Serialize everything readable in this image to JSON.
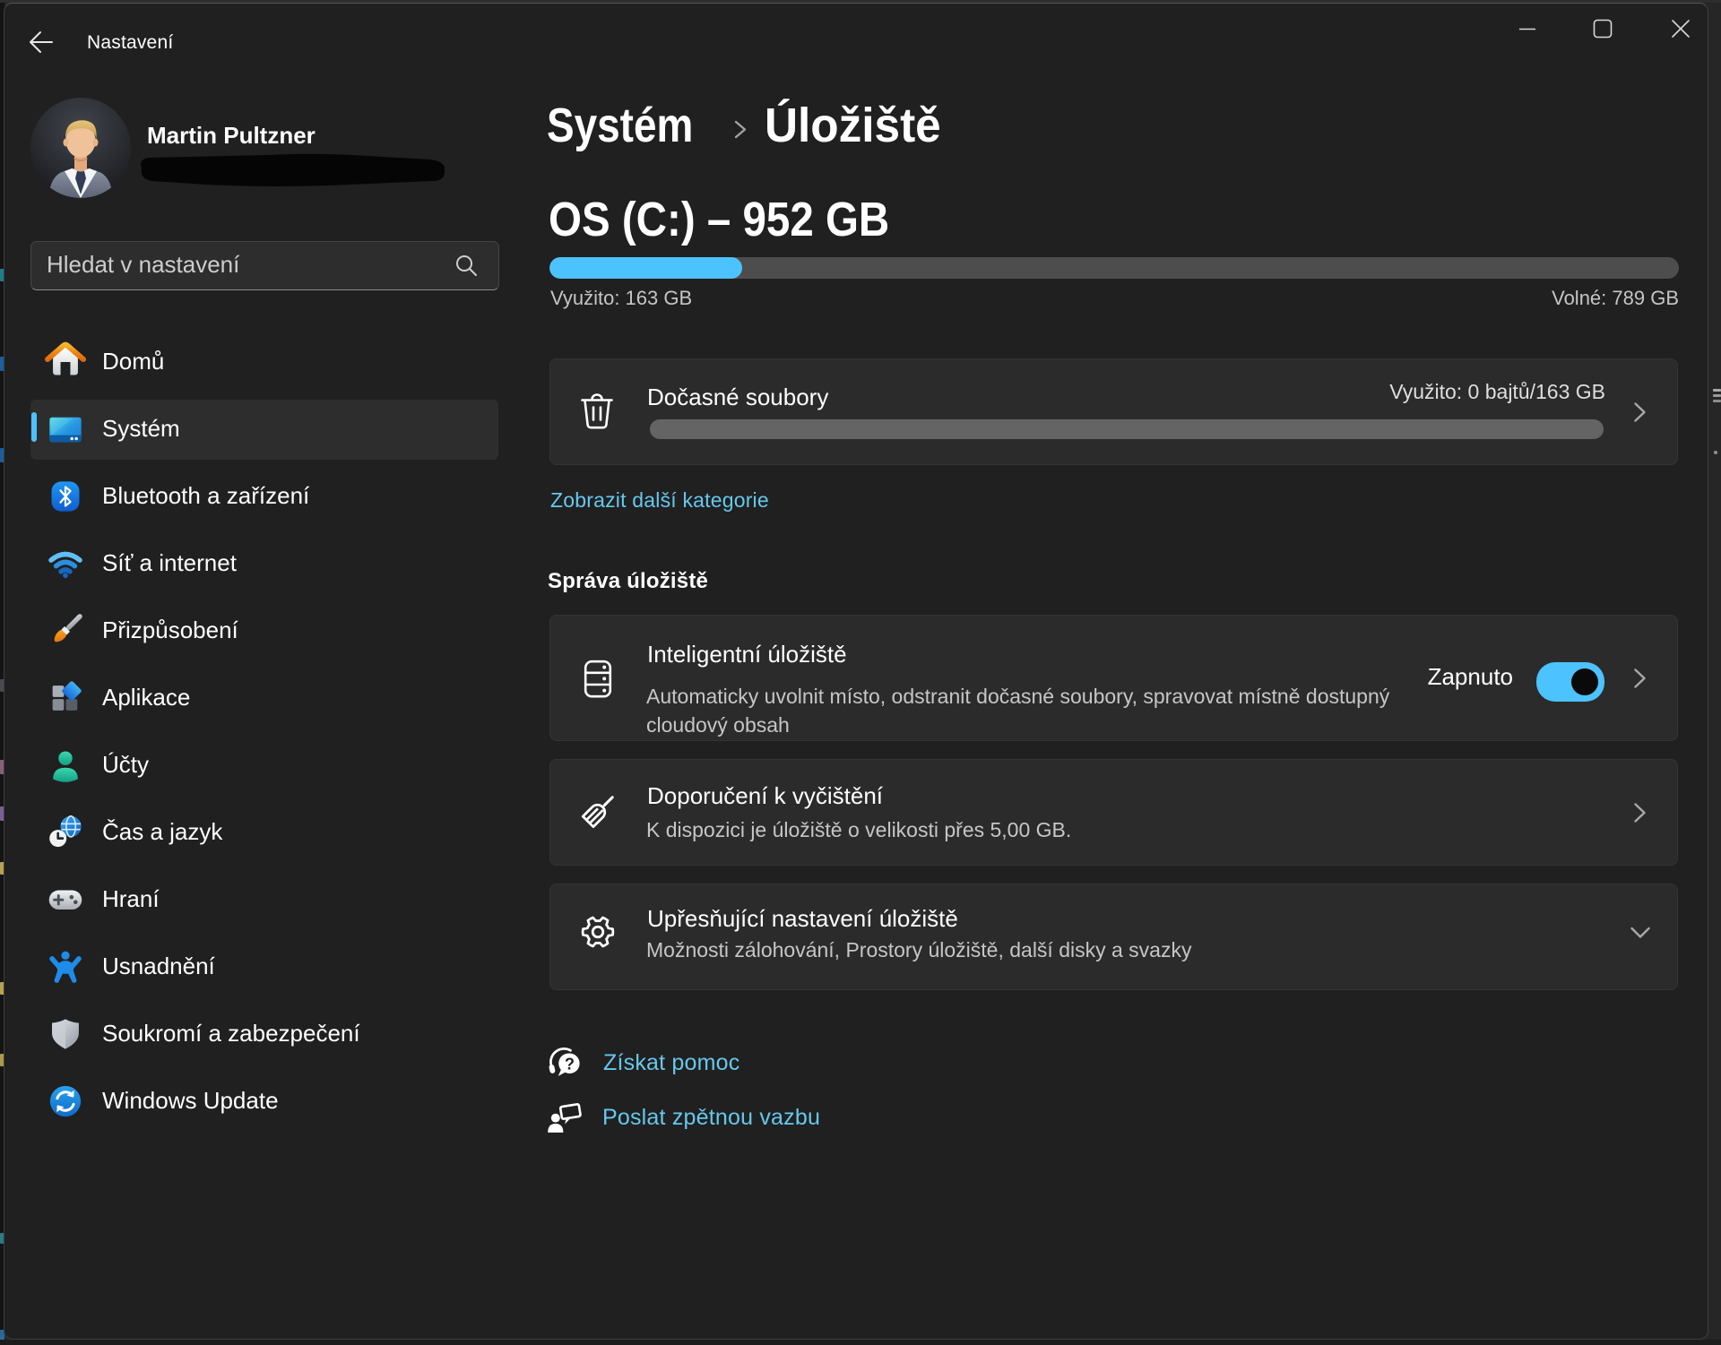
{
  "window": {
    "app_title": "Nastavení",
    "controls": {
      "minimize": "minimize",
      "maximize": "maximize",
      "close": "close"
    }
  },
  "sidebar": {
    "user": {
      "name": "Martin Pultzner",
      "email_redacted": true
    },
    "search": {
      "placeholder": "Hledat v nastavení"
    },
    "items": [
      {
        "label": "Domů",
        "icon": "home-icon",
        "selected": false
      },
      {
        "label": "Systém",
        "icon": "system-icon",
        "selected": true
      },
      {
        "label": "Bluetooth a zařízení",
        "icon": "bluetooth-icon",
        "selected": false
      },
      {
        "label": "Síť a internet",
        "icon": "network-icon",
        "selected": false
      },
      {
        "label": "Přizpůsobení",
        "icon": "personalization-icon",
        "selected": false
      },
      {
        "label": "Aplikace",
        "icon": "apps-icon",
        "selected": false
      },
      {
        "label": "Účty",
        "icon": "accounts-icon",
        "selected": false
      },
      {
        "label": "Čas a jazyk",
        "icon": "time-language-icon",
        "selected": false
      },
      {
        "label": "Hraní",
        "icon": "gaming-icon",
        "selected": false
      },
      {
        "label": "Usnadnění",
        "icon": "accessibility-icon",
        "selected": false
      },
      {
        "label": "Soukromí a zabezpečení",
        "icon": "privacy-icon",
        "selected": false
      },
      {
        "label": "Windows Update",
        "icon": "windows-update-icon",
        "selected": false
      }
    ]
  },
  "main": {
    "breadcrumb": {
      "parent": "Systém",
      "current": "Úložiště"
    },
    "drive": {
      "title": "OS (C:) – 952 GB",
      "used_label": "Využito: 163 GB",
      "free_label": "Volné: 789 GB",
      "used_percent": 17.1,
      "total_gb": 952,
      "used_gb": 163,
      "free_gb": 789
    },
    "temp_files": {
      "title": "Dočasné soubory",
      "value": "Využito: 0 bajtů/163 GB",
      "used_percent": 0
    },
    "show_more_link": "Zobrazit další kategorie",
    "section_header": "Správa úložiště",
    "smart_storage": {
      "title": "Inteligentní úložiště",
      "description": "Automaticky uvolnit místo, odstranit dočasné soubory, spravovat místně dostupný cloudový obsah",
      "toggle_label": "Zapnuto",
      "toggle_on": true
    },
    "cleanup": {
      "title": "Doporučení k vyčištění",
      "description": "K dispozici je úložiště o velikosti přes 5,00 GB."
    },
    "advanced": {
      "title": "Upřesňující nastavení úložiště",
      "description": "Možnosti zálohování, Prostory úložiště, další disky a svazky"
    },
    "footer_links": {
      "help": "Získat pomoc",
      "feedback": "Poslat zpětnou vazbu"
    }
  },
  "colors": {
    "accent": "#4cc2ff",
    "link": "#66c8ec",
    "window_bg": "#202020",
    "card_bg": "#2b2b2b",
    "progress_track": "#4d4d4d",
    "toggle_knob": "#0a0a0a"
  }
}
